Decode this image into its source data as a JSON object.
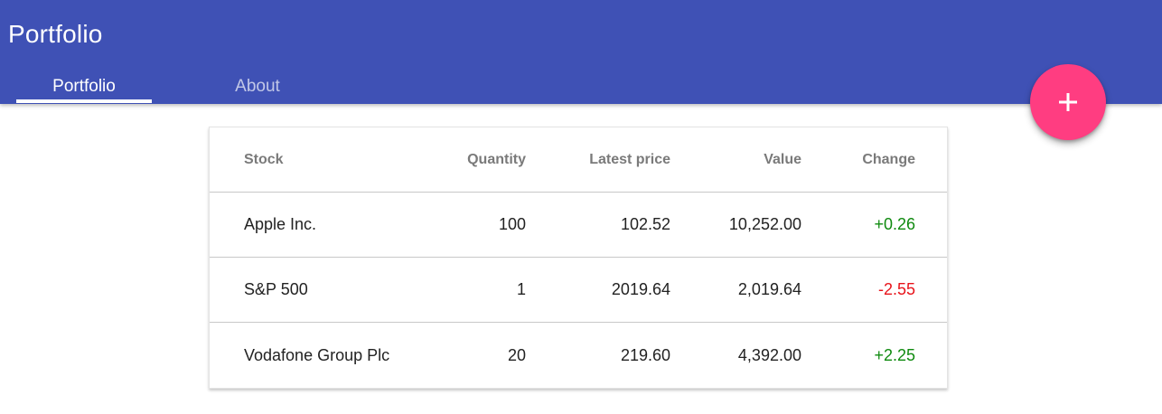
{
  "app": {
    "title": "Portfolio"
  },
  "tabs": [
    {
      "label": "Portfolio",
      "selected": true
    },
    {
      "label": "About",
      "selected": false
    }
  ],
  "fab": {
    "icon": "plus-icon"
  },
  "colors": {
    "app_bar": "#3f51b5",
    "fab": "#ff3d81",
    "positive": "#0f8a0f",
    "negative": "#e8141b"
  },
  "table": {
    "columns": [
      "Stock",
      "Quantity",
      "Latest price",
      "Value",
      "Change"
    ],
    "rows": [
      {
        "stock": "Apple Inc.",
        "quantity": "100",
        "latest_price": "102.52",
        "value": "10,252.00",
        "change": "+0.26",
        "direction": "up"
      },
      {
        "stock": "S&P 500",
        "quantity": "1",
        "latest_price": "2019.64",
        "value": "2,019.64",
        "change": "-2.55",
        "direction": "down"
      },
      {
        "stock": "Vodafone Group Plc",
        "quantity": "20",
        "latest_price": "219.60",
        "value": "4,392.00",
        "change": "+2.25",
        "direction": "up"
      }
    ]
  }
}
